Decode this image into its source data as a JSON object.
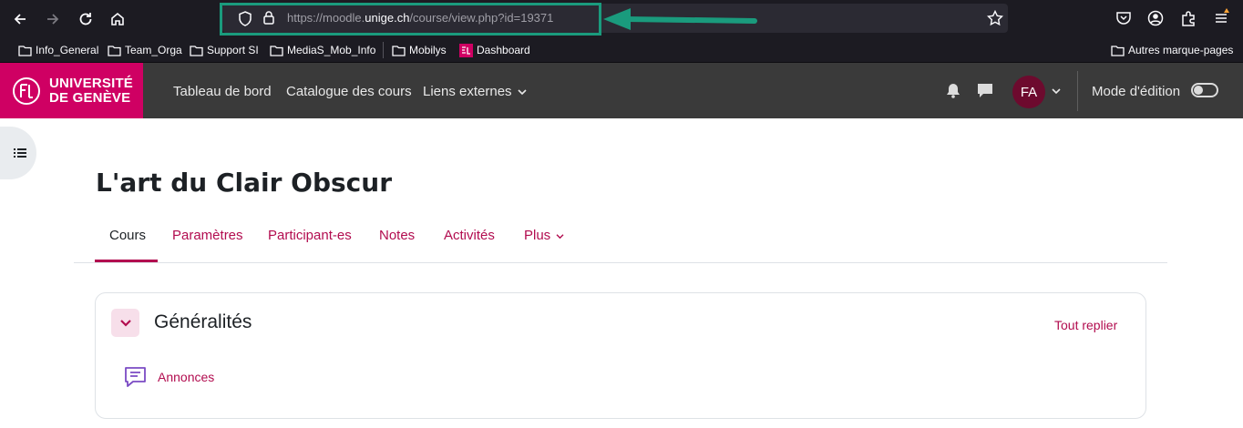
{
  "browser": {
    "url_prefix": "https://moodle.",
    "url_host": "unige.ch",
    "url_path": "/course/view.php?id=19371",
    "bookmarks": [
      {
        "label": "Info_General"
      },
      {
        "label": "Team_Orga"
      },
      {
        "label": "Support SI"
      },
      {
        "label": "MediaS_Mob_Info"
      },
      {
        "label": "Mobilys"
      },
      {
        "label": "Dashboard"
      }
    ],
    "other_bookmarks": "Autres marque-pages",
    "icons": [
      "back-icon",
      "forward-icon",
      "reload-icon",
      "home-icon",
      "shield-icon",
      "lock-icon",
      "star-icon",
      "pocket-icon",
      "account-icon",
      "extensions-icon",
      "menu-icon"
    ]
  },
  "navbar": {
    "logo_line1": "UNIVERSITÉ",
    "logo_line2": "DE GENÈVE",
    "links": [
      "Tableau de bord",
      "Catalogue des cours",
      "Liens externes"
    ],
    "avatar_initials": "FA",
    "edit_mode_label": "Mode d'édition",
    "edit_mode_on": false
  },
  "course": {
    "title": "L'art du Clair Obscur",
    "tabs": [
      {
        "label": "Cours",
        "active": true
      },
      {
        "label": "Paramètres"
      },
      {
        "label": "Participant-es"
      },
      {
        "label": "Notes"
      },
      {
        "label": "Activités"
      },
      {
        "label": "Plus"
      }
    ],
    "section": {
      "title": "Généralités",
      "collapse_all": "Tout replier",
      "activities": [
        {
          "label": "Annonces",
          "icon": "forum-icon"
        }
      ]
    }
  },
  "colors": {
    "brand": "#cf0063",
    "link": "#b20c4f",
    "highlight": "#1a9b7d",
    "navbar": "#3a3a3a"
  }
}
